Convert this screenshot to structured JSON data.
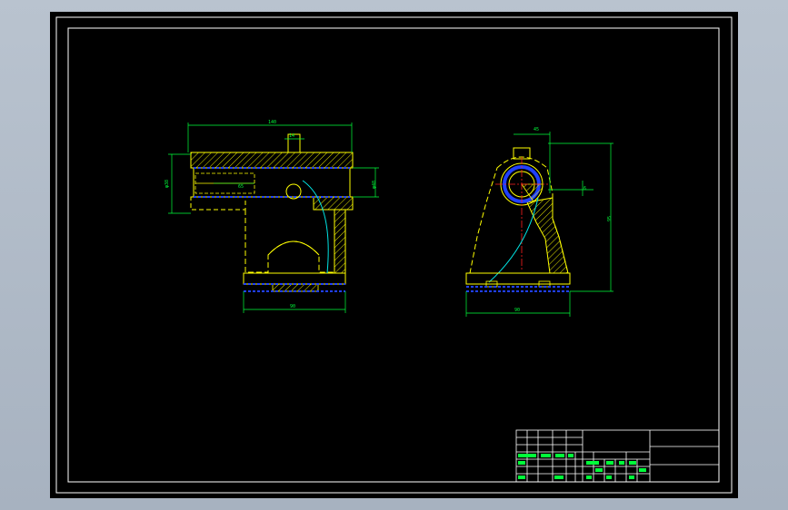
{
  "dimensions": {
    "front_overall_width": "140",
    "front_slot_width": "14",
    "front_left_height": "φ38",
    "front_bore_label": "65",
    "front_right_height": "φ48",
    "front_base_width": "90",
    "side_top_width": "45",
    "side_small_offset": "6",
    "side_total_height": "95",
    "side_base_width": "90"
  },
  "colors": {
    "outline": "#ffff00",
    "dimension": "#00ff3a",
    "hatch": "#ffff00",
    "centerline": "#ff2020",
    "hidden": "#2040ff",
    "section_curve": "#00e5e5",
    "border": "#ffffff"
  }
}
